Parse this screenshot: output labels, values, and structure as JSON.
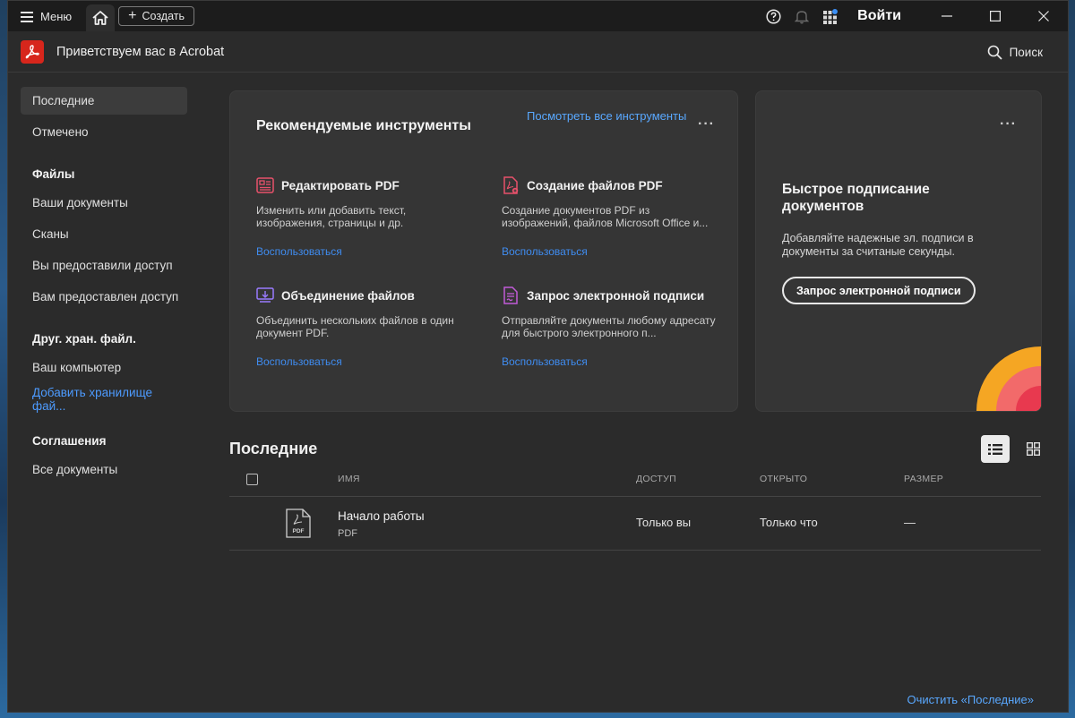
{
  "titlebar": {
    "menu_label": "Меню",
    "create_label": "Создать",
    "signin_label": "Войти",
    "icons": [
      "home-icon",
      "help-icon",
      "bell-icon",
      "apps-icon",
      "minimize-icon",
      "maximize-icon",
      "close-icon"
    ]
  },
  "header": {
    "title": "Приветствуем вас в Acrobat",
    "search_label": "Поиск"
  },
  "sidebar": {
    "items_top": [
      {
        "label": "Последние",
        "active": true
      },
      {
        "label": "Отмечено"
      }
    ],
    "sections": [
      {
        "heading": "Файлы",
        "items": [
          "Ваши документы",
          "Сканы",
          "Вы предоставили доступ",
          "Вам предоставлен доступ"
        ]
      },
      {
        "heading": "Друг. хран. файл.",
        "items": [
          "Ваш компьютер"
        ],
        "link": "Добавить хранилище фай..."
      },
      {
        "heading": "Соглашения",
        "items": [
          "Все документы"
        ]
      }
    ]
  },
  "tools_card": {
    "title": "Рекомендуемые инструменты",
    "see_all": "Посмотреть все инструменты",
    "tools": [
      {
        "name": "Редактировать PDF",
        "desc": "Изменить или добавить текст, изображения, страницы и др.",
        "link": "Воспользоваться",
        "icon": "edit-pdf-icon",
        "color": "#e8516b"
      },
      {
        "name": "Создание файлов PDF",
        "desc": "Создание документов PDF из изображений, файлов Microsoft Office и...",
        "link": "Воспользоваться",
        "icon": "create-pdf-icon",
        "color": "#e8516b"
      },
      {
        "name": "Объединение файлов",
        "desc": "Объединить нескольких файлов в один документ PDF.",
        "link": "Воспользоваться",
        "icon": "combine-files-icon",
        "color": "#9a7bff"
      },
      {
        "name": "Запрос электронной подписи",
        "desc": "Отправляйте документы любому адресату для быстрого электронного п...",
        "link": "Воспользоваться",
        "icon": "request-signature-icon",
        "color": "#c25bd8"
      }
    ]
  },
  "sign_card": {
    "title": "Быстрое подписание документов",
    "desc": "Добавляйте надежные эл. подписи в документы за считаные секунды.",
    "button": "Запрос электронной подписи"
  },
  "recent": {
    "title": "Последние",
    "columns": {
      "name": "ИМЯ",
      "access": "ДОСТУП",
      "opened": "ОТКРЫТО",
      "size": "РАЗМЕР"
    },
    "rows": [
      {
        "name": "Начало работы",
        "type": "PDF",
        "access": "Только вы",
        "opened": "Только что",
        "size": "—"
      }
    ],
    "clear": "Очистить «Последние»"
  },
  "colors": {
    "accent_link": "#59a8ff",
    "brand_red": "#d7261c"
  }
}
